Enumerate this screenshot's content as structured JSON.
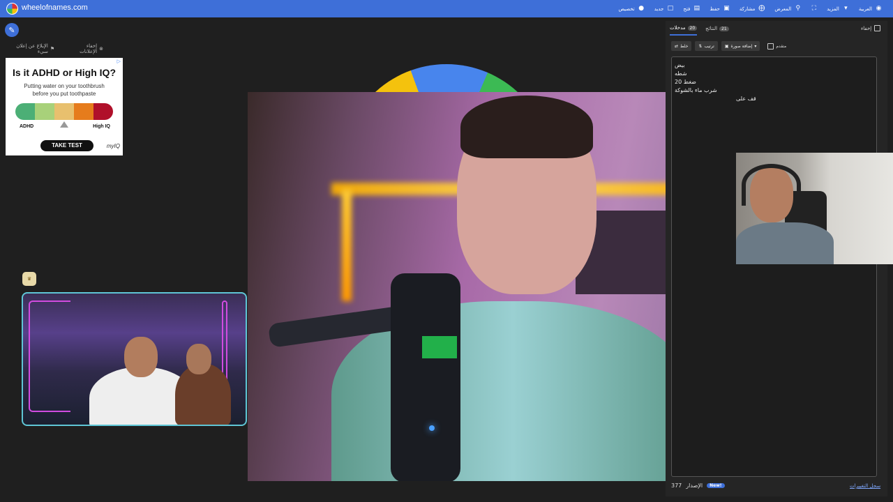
{
  "app": {
    "brand": "wheelofnames.com"
  },
  "topmenu": [
    {
      "label": "العربية",
      "icon": "globe-icon"
    },
    {
      "label": "المزيد",
      "icon": "caret-down-icon"
    },
    {
      "label": "",
      "icon": "fullscreen-icon"
    },
    {
      "label": "المعرض",
      "icon": "search-icon"
    },
    {
      "label": "مشاركة",
      "icon": "share-icon"
    },
    {
      "label": "حفظ",
      "icon": "save-icon"
    },
    {
      "label": "فتح",
      "icon": "folder-icon"
    },
    {
      "label": "جديد",
      "icon": "file-icon"
    },
    {
      "label": "تخصيص",
      "icon": "palette-icon"
    }
  ],
  "ads": {
    "hide_label": "إخفاء الإعلانات",
    "report_label": "الإبلاغ عن إعلان سيء",
    "card": {
      "title": "Is it ADHD or High IQ?",
      "subtitle_1": "Putting water on your toothbrush",
      "subtitle_2": "before you put toothpaste",
      "left_label": "ADHD",
      "right_label": "High IQ",
      "cta": "TAKE TEST",
      "brand": "myIQ",
      "scale_colors": [
        "#4caf76",
        "#a8d17a",
        "#e8c06e",
        "#e67c1c",
        "#b0102a"
      ]
    }
  },
  "panel": {
    "hide_label": "إخفاء",
    "tabs": [
      {
        "label": "مدخلات",
        "count": "20"
      },
      {
        "label": "النتائج",
        "count": "21"
      }
    ],
    "toolbar": {
      "shuffle_label": "خلط",
      "sort_label": "ترتيب",
      "add_image_label": "إضافة صورة",
      "advanced_label": "متقدم"
    },
    "entries": [
      "بيض",
      "شطه",
      "ضغط 20",
      "شرب ماء بالشوكة",
      "قف على"
    ],
    "footer": {
      "version_label": "الإصدار",
      "version": "377",
      "new_badge": "New!",
      "changelog_link": "سجل التغييرات"
    }
  }
}
